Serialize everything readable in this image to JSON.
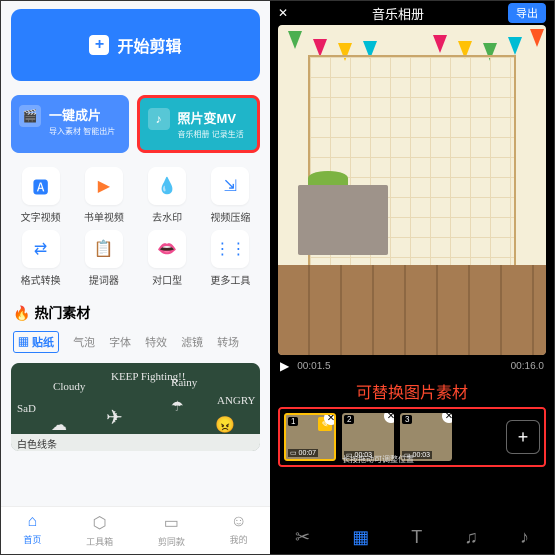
{
  "left": {
    "start_edit": "开始剪辑",
    "card1": {
      "title": "一键成片",
      "sub": "导入素材 智能出片"
    },
    "card2": {
      "title": "照片变MV",
      "sub": "音乐相册 记录生活"
    },
    "tools": [
      {
        "icon": "🅰",
        "label": "文字视频",
        "color": "#2a7fff"
      },
      {
        "icon": "▶",
        "label": "书单视频",
        "color": "#ff7a2e"
      },
      {
        "icon": "💧",
        "label": "去水印",
        "color": "#2a7fff"
      },
      {
        "icon": "⇲",
        "label": "视频压缩",
        "color": "#2a7fff"
      },
      {
        "icon": "⇄",
        "label": "格式转换",
        "color": "#2a7fff"
      },
      {
        "icon": "📋",
        "label": "提词器",
        "color": "#ff7a2e"
      },
      {
        "icon": "👄",
        "label": "对口型",
        "color": "#ff4a6e"
      },
      {
        "icon": "⋮⋮",
        "label": "更多工具",
        "color": "#2a7fff"
      }
    ],
    "hot_title": "热门素材",
    "tabs": [
      "贴纸",
      "气泡",
      "字体",
      "特效",
      "滤镜",
      "转场"
    ],
    "doodles": [
      "SaD",
      "Cloudy",
      "KEEP Fighting!!",
      "Rainy",
      "ANGRY"
    ],
    "bb_caption": "白色线条",
    "nav": [
      {
        "icon": "⌂",
        "label": "首页"
      },
      {
        "icon": "⬡",
        "label": "工具箱"
      },
      {
        "icon": "▭",
        "label": "剪同款"
      },
      {
        "icon": "☺",
        "label": "我的"
      }
    ]
  },
  "right": {
    "title": "音乐相册",
    "export": "导出",
    "time_current": "00:01.5",
    "time_total": "00:16.0",
    "replace_label": "可替换图片素材",
    "clips": [
      {
        "num": "1",
        "dur": "00:07"
      },
      {
        "num": "2",
        "dur": "00:03"
      },
      {
        "num": "3",
        "dur": "00:03"
      }
    ],
    "clips_hint": "长按拖动可调整位置",
    "bottom_icons": [
      "✂",
      "▦",
      "T",
      "♫",
      "♪"
    ]
  }
}
